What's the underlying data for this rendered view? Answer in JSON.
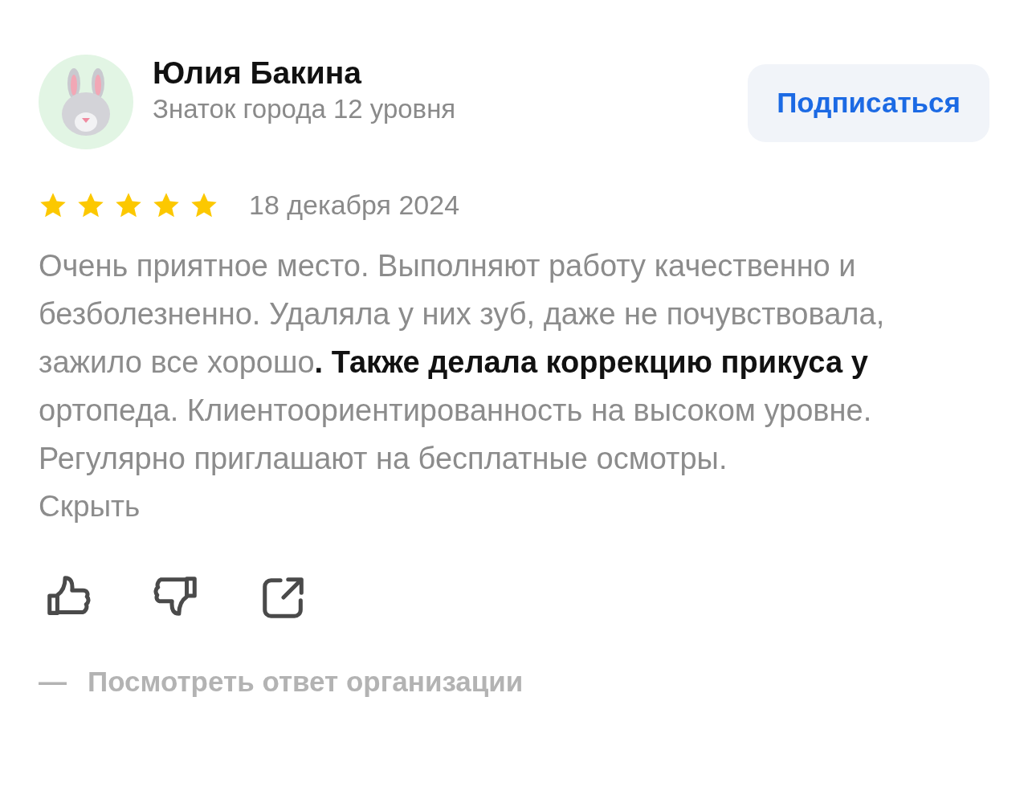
{
  "author": {
    "name": "Юлия Бакина",
    "level": "Знаток города 12 уровня"
  },
  "subscribe_button": {
    "label": "Подписаться"
  },
  "rating": {
    "stars": 5,
    "date": "18 декабря 2024"
  },
  "review": {
    "text": "Очень приятное место. Выполняют работу качественно и безболезненно. Удаляла у них зуб, даже не почувствовала, зажило все хорошо**. Также делала коррекцию прикуса у** ортопеда. Клиентоориентированность на высоком уровне. Регулярно приглашают на бесплатные осмотры.",
    "toggle": "Скрыть"
  },
  "actions": [
    {
      "kind": "like"
    },
    {
      "kind": "dislike"
    },
    {
      "kind": "share"
    }
  ],
  "reply_link": {
    "dash": "—",
    "label": "Посмотреть ответ организации"
  }
}
